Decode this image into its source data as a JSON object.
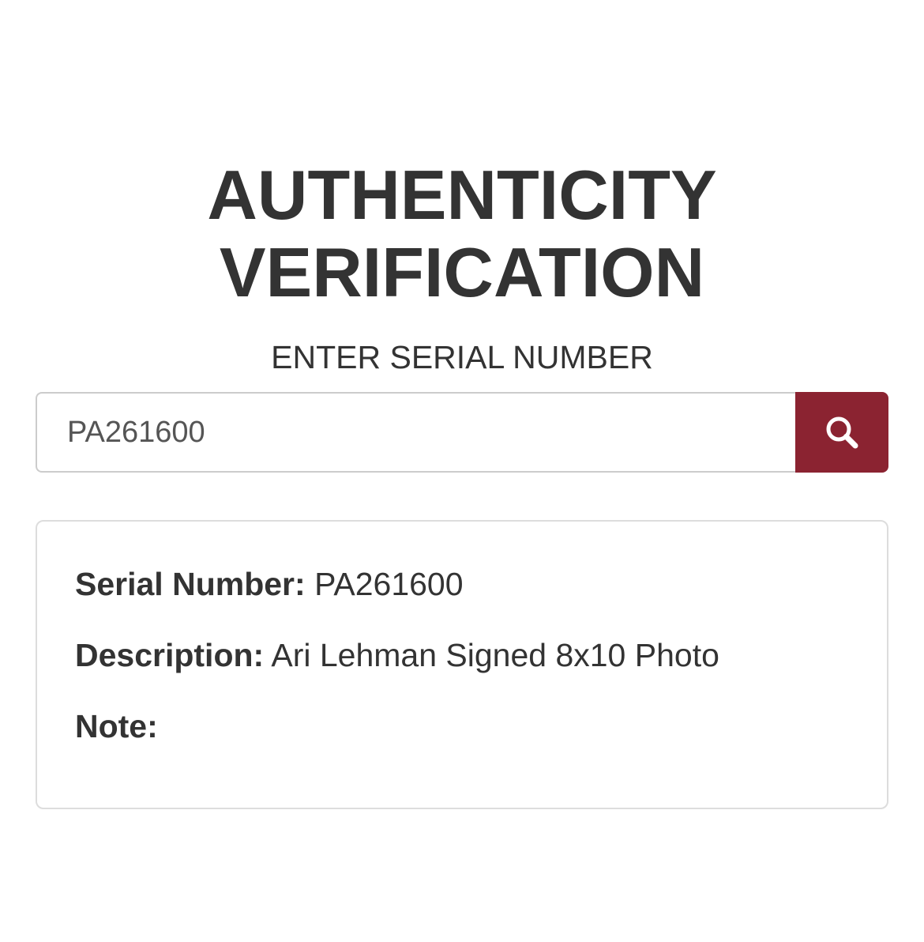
{
  "header": {
    "title_line1": "AUTHENTICITY",
    "title_line2": "VERIFICATION",
    "subtitle": "ENTER SERIAL NUMBER"
  },
  "search": {
    "value": "PA261600",
    "placeholder": "",
    "button_icon": "search-icon",
    "button_color": "#8b2331"
  },
  "result": {
    "serial_label": "Serial Number:",
    "serial_value": "PA261600",
    "description_label": "Description:",
    "description_value": "Ari Lehman Signed 8x10 Photo",
    "note_label": "Note:",
    "note_value": ""
  }
}
